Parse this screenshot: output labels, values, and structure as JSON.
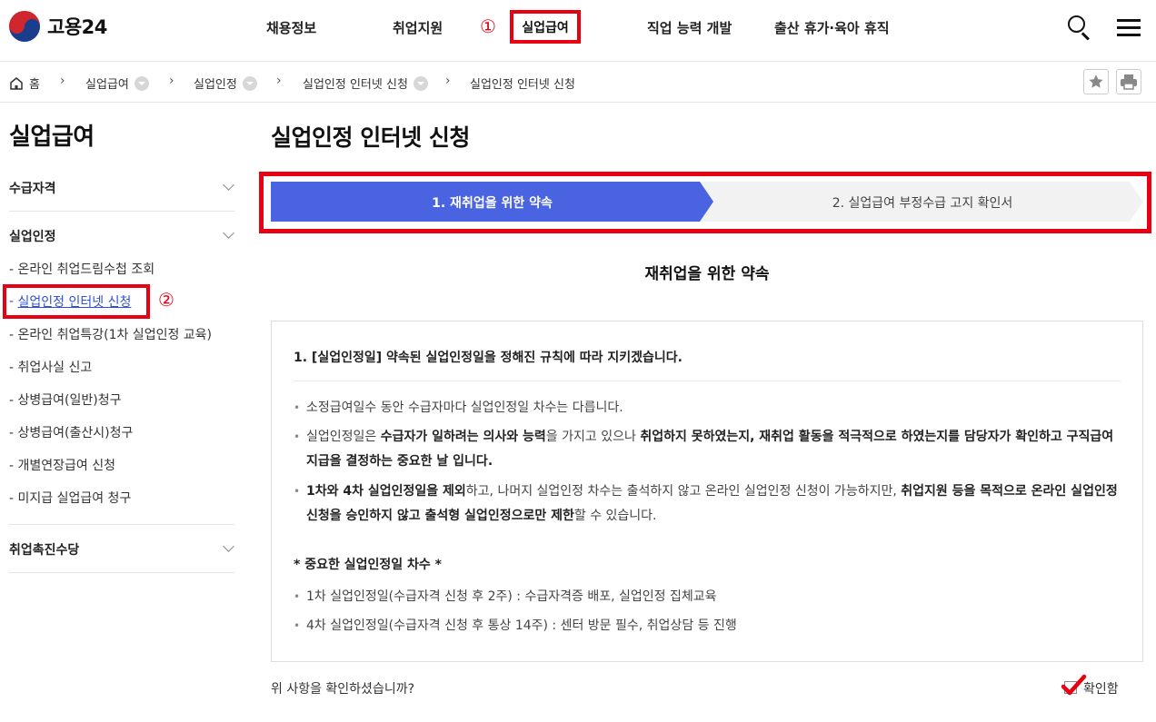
{
  "header": {
    "logo_text": "고용24",
    "nav": [
      "채용정보",
      "취업지원",
      "실업급여",
      "직업 능력 개발",
      "출산 휴가·육아 휴직"
    ],
    "active_nav": "실업급여",
    "marker1": "①"
  },
  "breadcrumb": {
    "home": "홈",
    "items": [
      "실업급여",
      "실업인정",
      "실업인정 인터넷 신청",
      "실업인정 인터넷 신청"
    ]
  },
  "sidebar": {
    "title": "실업급여",
    "sections": [
      "수급자격",
      "실업인정",
      "취업촉진수당"
    ],
    "subitems": [
      "- 온라인 취업드림수첩 조회",
      "실업인정 인터넷 신청",
      "- 온라인 취업특강(1차 실업인정 교육)",
      "- 취업사실 신고",
      "- 상병급여(일반)청구",
      "- 상병급여(출산시)청구",
      "- 개별연장급여 신청",
      "- 미지급 실업급여 청구"
    ],
    "active_prefix": "- ",
    "marker2": "②"
  },
  "main": {
    "title": "실업인정 인터넷 신청",
    "steps": [
      "1. 재취업을 위한 약속",
      "2. 실업급여 부정수급 고지 확인서"
    ],
    "step_colors": {
      "active": "#4a63e0",
      "inactive": "#f2f2f2"
    },
    "section_title": "재취업을 위한 약속",
    "box": {
      "heading": "1. [실업인정일] 약속된 실업인정일을 정해진 규칙에 따라 지키겠습니다.",
      "b1": "소정급여일수 동안 수급자마다 실업인정일 차수는 다릅니다.",
      "b2_1": "실업인정일은 ",
      "b2_2": "수급자가 일하려는 의사와 능력",
      "b2_3": "을 가지고 있으나 ",
      "b2_4": "취업하지 못하였는지, 재취업 활동을 적극적으로 하였는지를 담당자가 확인하고 구직급여 지급을 결정하는 중요한 날 입니다.",
      "b3_1": "1차와 4차 실업인정일을 제외",
      "b3_2": "하고, 나머지 실업인정 차수는 출석하지 않고 온라인 실업인정 신청이 가능하지만, ",
      "b3_3": "취업지원 등을 목적으로 온라인 실업인정 신청을 승인하지 않고 출석형 실업인정으로만 제한",
      "b3_4": "할 수 있습니다.",
      "sub_heading": "* 중요한 실업인정일 차수 *",
      "b4": "1차 실업인정일(수급자격 신청 후 2주) : 수급자격증 배포, 실업인정 집체교육",
      "b5": "4차 실업인정일(수급자격 신청 후 통상 14주) : 센터 방문 필수, 취업상담 등 진행"
    },
    "confirm_question": "위 사항을 확인하셨습니까?",
    "confirm_label": "확인함"
  }
}
